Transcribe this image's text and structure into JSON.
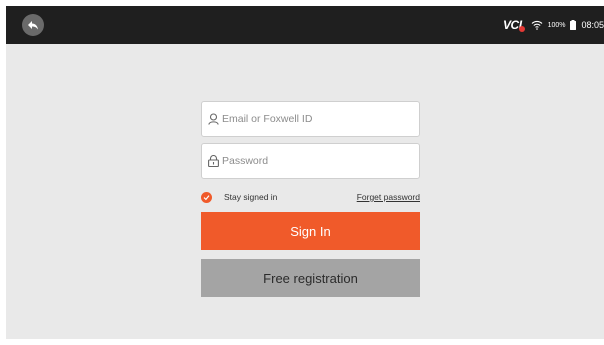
{
  "status_bar": {
    "vci_label": "VCI",
    "battery_percent": "100%",
    "time": "08:05",
    "icons": [
      "back-arrow-icon",
      "wifi-icon",
      "battery-icon"
    ]
  },
  "login": {
    "email_placeholder": "Email or Foxwell ID",
    "password_placeholder": "Password",
    "stay_signed_in_label": "Stay signed in",
    "stay_signed_in_checked": true,
    "forget_password_label": "Forget password",
    "sign_in_label": "Sign In",
    "register_label": "Free registration"
  },
  "colors": {
    "accent": "#f05a2a",
    "register_button": "#a4a4a4",
    "top_bar": "#1f1f1f",
    "background": "#e9e9e9"
  }
}
